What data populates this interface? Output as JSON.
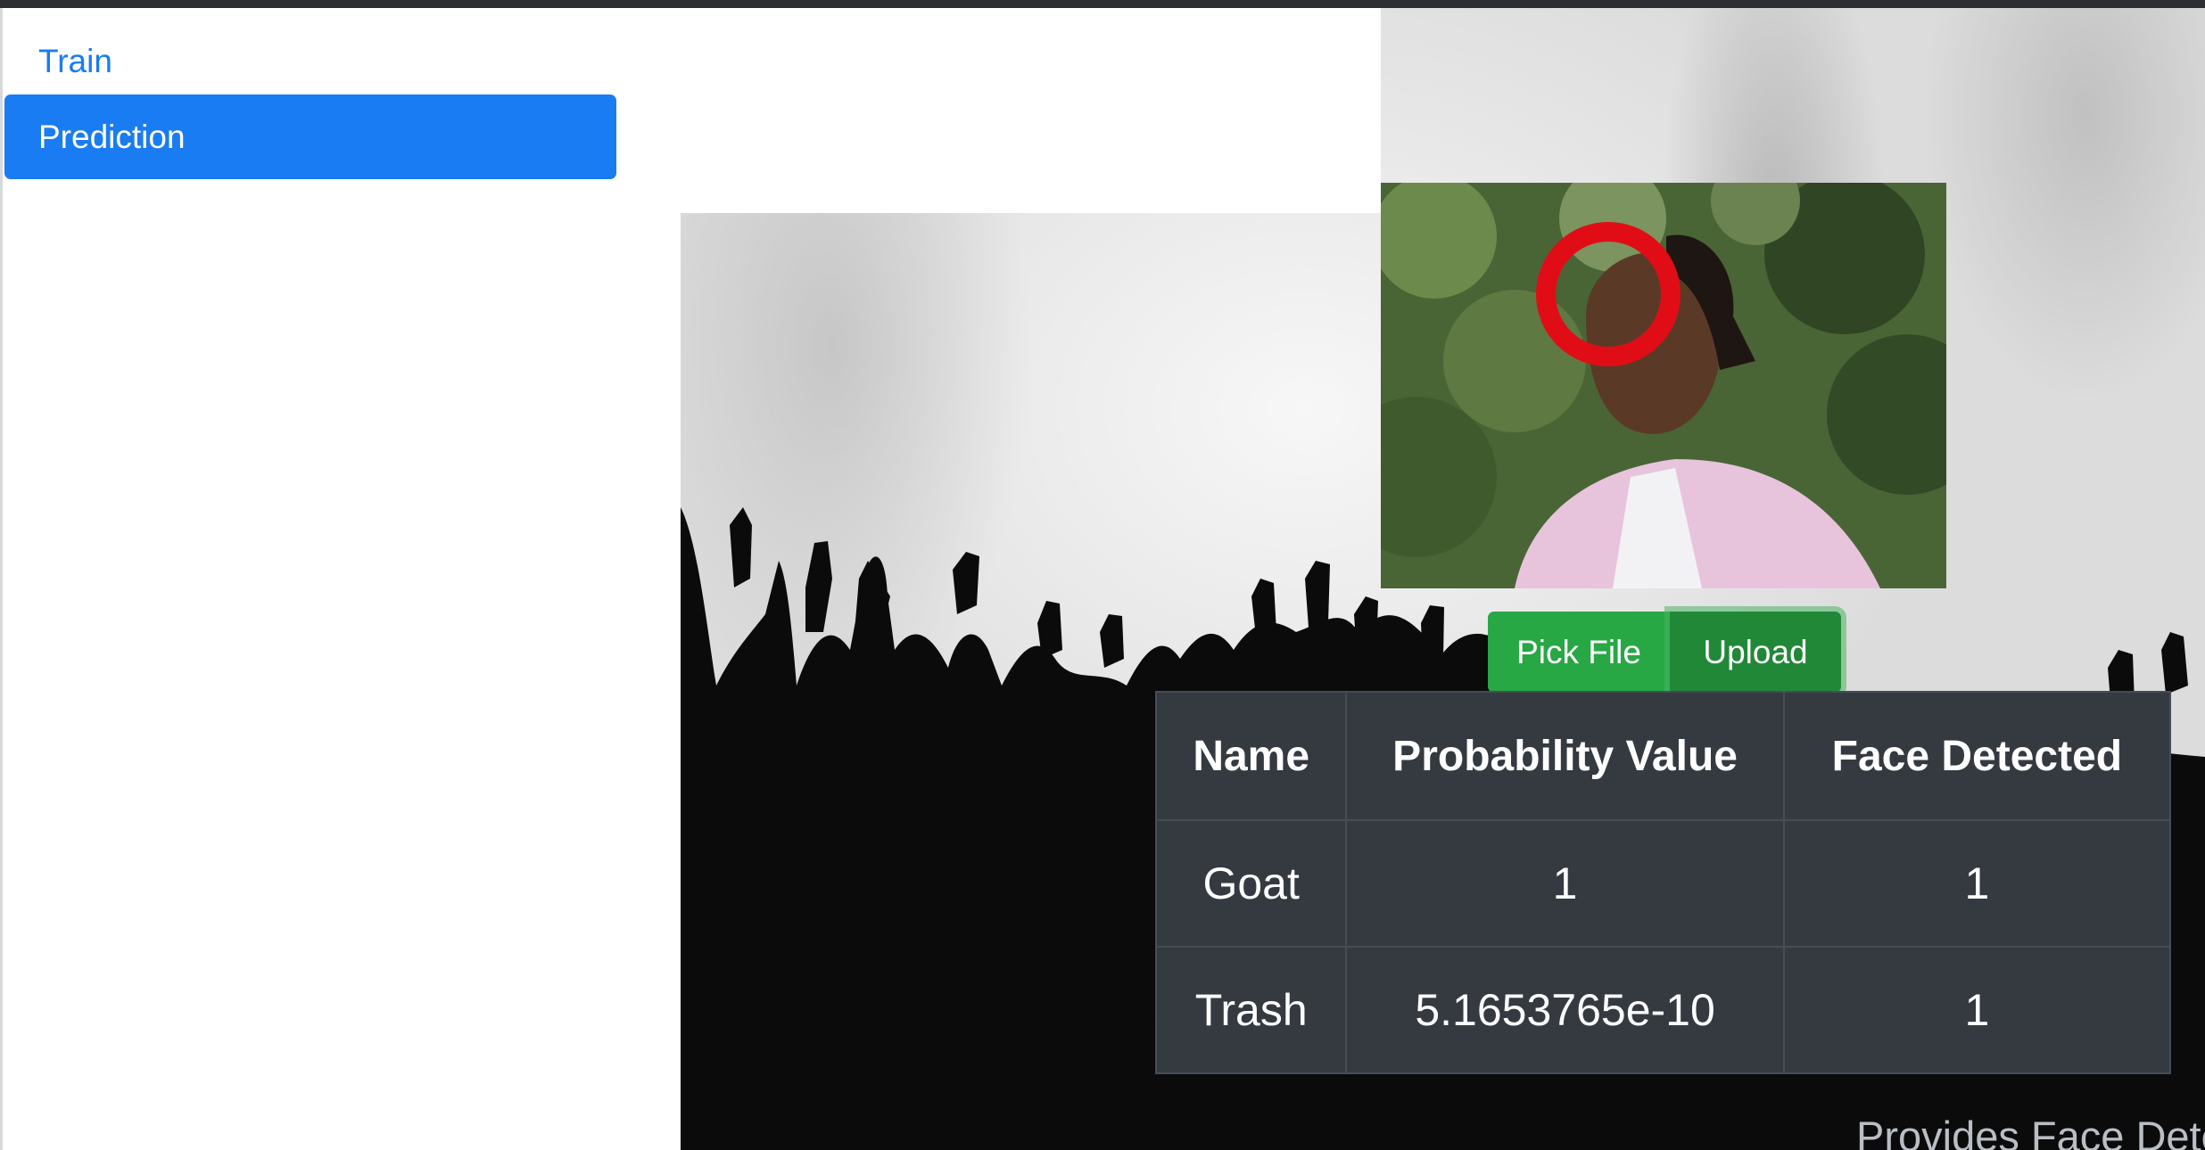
{
  "sidebar": {
    "items": [
      {
        "label": "Train",
        "active": false
      },
      {
        "label": "Prediction",
        "active": true
      }
    ]
  },
  "colors": {
    "accent": "#1a7cf2",
    "success": "#28a745",
    "success_dark": "#218838",
    "table_bg": "#343a40"
  },
  "uploader": {
    "pick_label": "Pick File",
    "upload_label": "Upload"
  },
  "results": {
    "headers": [
      "Name",
      "Probability Value",
      "Face Detected"
    ],
    "rows": [
      [
        "Goat",
        "1",
        "1"
      ],
      [
        "Trash",
        "5.1653765e-10",
        "1"
      ]
    ]
  },
  "caption": "Provides Face Detection Value of Artist"
}
